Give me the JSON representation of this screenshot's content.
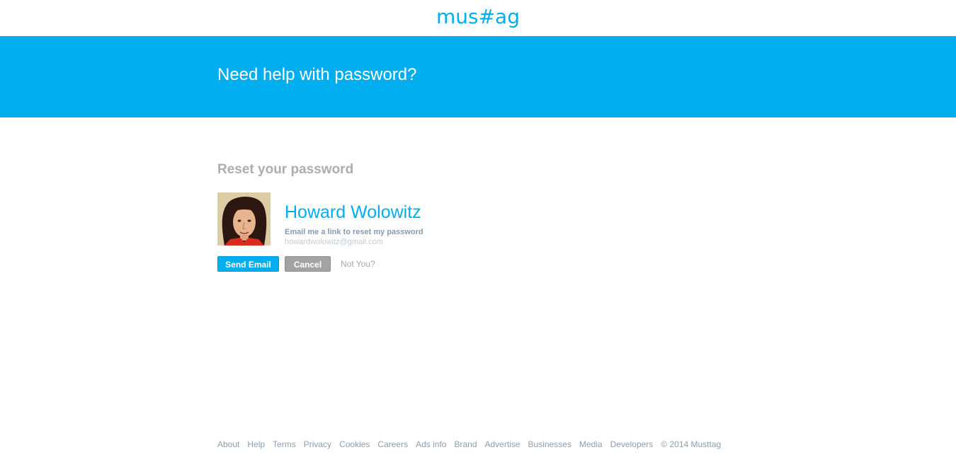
{
  "header": {
    "logo_text": "mus#ag"
  },
  "hero": {
    "title": "Need help with password?"
  },
  "reset": {
    "section_title": "Reset your password",
    "user_name": "Howard Wolowitz",
    "email_hint": "Email me a link to reset my password",
    "email": "howardwolowitz@gmail.com",
    "send_label": "Send Email",
    "cancel_label": "Cancel",
    "not_you_label": "Not You?"
  },
  "footer": {
    "links": [
      "About",
      "Help",
      "Terms",
      "Privacy",
      "Cookies",
      "Careers",
      "Ads info",
      "Brand",
      "Advertise",
      "Businesses",
      "Media",
      "Developers"
    ],
    "copyright": "© 2014 Musttag"
  },
  "colors": {
    "brand": "#00aeef",
    "cancel": "#a3a3a3",
    "footer_text": "#8d9fae"
  }
}
